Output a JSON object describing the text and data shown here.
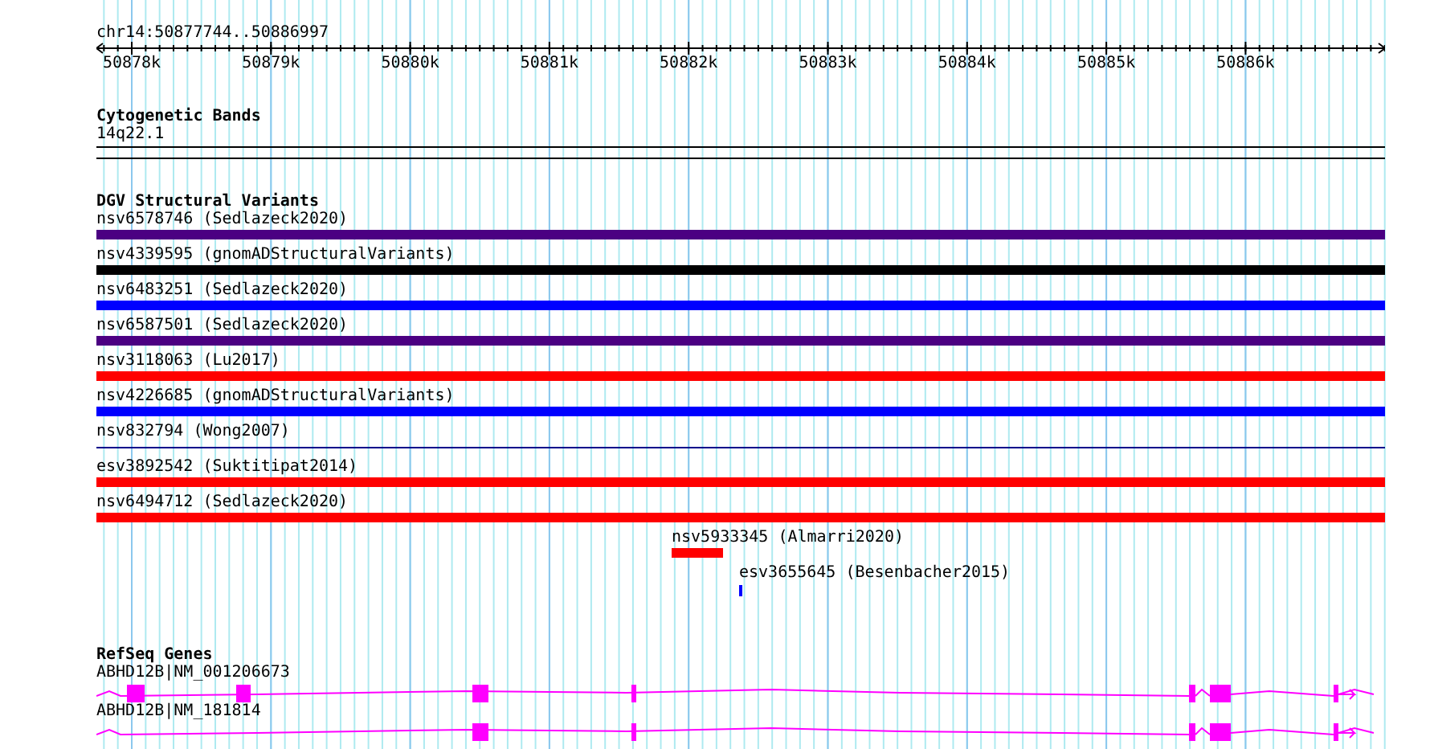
{
  "ruler": {
    "position": "chr14:50877744..50886997",
    "ticks": [
      "50878k",
      "50879k",
      "50880k",
      "50881k",
      "50882k",
      "50883k",
      "50884k",
      "50885k",
      "50886k"
    ]
  },
  "cytogenetic_bands": {
    "title": "Cytogenetic Bands",
    "band": "14q22.1"
  },
  "dgv_structural_variants": {
    "title": "DGV Structural Variants",
    "variants": [
      {
        "label": "nsv6578746 (Sedlazeck2020)",
        "color": "#4b0082",
        "kind": "bar"
      },
      {
        "label": "nsv4339595 (gnomADStructuralVariants)",
        "color": "#000000",
        "kind": "bar"
      },
      {
        "label": "nsv6483251 (Sedlazeck2020)",
        "color": "#0000ff",
        "kind": "bar"
      },
      {
        "label": "nsv6587501 (Sedlazeck2020)",
        "color": "#4b0082",
        "kind": "bar"
      },
      {
        "label": "nsv3118063 (Lu2017)",
        "color": "#ff0000",
        "kind": "bar"
      },
      {
        "label": "nsv4226685 (gnomADStructuralVariants)",
        "color": "#0000ff",
        "kind": "bar"
      },
      {
        "label": "nsv832794 (Wong2007)",
        "color": "#00008b",
        "kind": "line"
      },
      {
        "label": "esv3892542 (Suktitipat2014)",
        "color": "#ff0000",
        "kind": "bar"
      },
      {
        "label": "nsv6494712 (Sedlazeck2020)",
        "color": "#ff0000",
        "kind": "bar"
      },
      {
        "label": "nsv5933345 (Almarri2020)",
        "color": "#ff0000",
        "kind": "bar"
      },
      {
        "label": "esv3655645 (Besenbacher2015)",
        "color": "#0000ff",
        "kind": "tick"
      }
    ]
  },
  "refseq_genes": {
    "title": "RefSeq Genes",
    "genes": [
      {
        "label": "ABHD12B|NM_001206673"
      },
      {
        "label": "ABHD12B|NM_181814"
      }
    ]
  }
}
